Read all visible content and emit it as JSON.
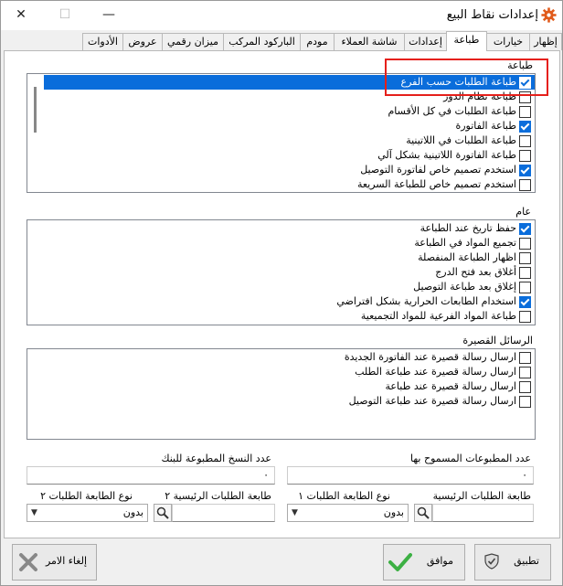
{
  "window": {
    "title": "إعدادات نقاط البيع",
    "close_label": "✕",
    "maximize_label": "☐",
    "minimize_label": "—"
  },
  "tabs": [
    {
      "label": "إظهار",
      "active": false
    },
    {
      "label": "خيارات",
      "active": false
    },
    {
      "label": "طباعة",
      "active": true
    },
    {
      "label": "إعدادات",
      "active": false
    },
    {
      "label": "شاشة العملاء",
      "active": false
    },
    {
      "label": "مودم",
      "active": false
    },
    {
      "label": "الباركود المركب",
      "active": false
    },
    {
      "label": "ميزان رقمي",
      "active": false
    },
    {
      "label": "عروض",
      "active": false
    },
    {
      "label": "الأدوات",
      "active": false
    }
  ],
  "print_section": {
    "title": "طباعة",
    "items": [
      {
        "label": "طباعة الطلبات حسب الفرع",
        "checked": true,
        "selected": true
      },
      {
        "label": "طباعة نظام الدور",
        "checked": false
      },
      {
        "label": "طباعة الطلبات في كل الأقسام",
        "checked": false
      },
      {
        "label": "طباعة الفاتورة",
        "checked": true
      },
      {
        "label": "طباعة الطلبات في اللاتينية",
        "checked": false
      },
      {
        "label": "طباعة الفاتورة اللاتينية بشكل آلي",
        "checked": false
      },
      {
        "label": "استخدم تصميم خاص لفاتورة التوصيل",
        "checked": true
      },
      {
        "label": "استخدم تصميم خاص للطباعة السريعة",
        "checked": false
      }
    ]
  },
  "general_section": {
    "title": "عام",
    "items": [
      {
        "label": "حفظ تاريخ عند الطباعة",
        "checked": true
      },
      {
        "label": "تجميع المواد في الطباعة",
        "checked": false
      },
      {
        "label": "اظهار الطباعة المنفصلة",
        "checked": false
      },
      {
        "label": "أغلاق بعد فتح الدرج",
        "checked": false
      },
      {
        "label": "إغلاق بعد طباعة التوصيل",
        "checked": false
      },
      {
        "label": "استخدام الطابعات الحرارية بشكل افتراضي",
        "checked": true
      },
      {
        "label": "طباعة المواد الفرعية للمواد التجميعية",
        "checked": false
      }
    ]
  },
  "sms_section": {
    "title": "الرسائل القصيرة",
    "items": [
      {
        "label": "ارسال رسالة قصيرة عند الفاتورة الجديدة",
        "checked": false
      },
      {
        "label": "ارسال رسالة قصيرة عند طباعة الطلب",
        "checked": false
      },
      {
        "label": "ارسال رسالة قصيرة عند طباعة",
        "checked": false
      },
      {
        "label": "ارسال رسالة قصيرة عند طباعة التوصيل",
        "checked": false
      }
    ]
  },
  "fields": {
    "allowed_prints_label": "عدد المطبوعات المسموح بها",
    "allowed_prints_value": "٠",
    "bank_copies_label": "عدد النسخ المطبوعة للبنك",
    "bank_copies_value": "٠",
    "main_orders_printer_label": "طابعة الطلبات الرئيسية",
    "order_printer_type1_label": "نوع الطابعة الطلبات ١",
    "order_printer_type1_value": "بدون",
    "main_orders_printer2_label": "طابعة الطلبات الرئيسية ٢",
    "order_printer_type2_label": "نوع الطابعة الطلبات ٢",
    "order_printer_type2_value": "بدون"
  },
  "buttons": {
    "apply": "تطبيق",
    "ok": "موافق",
    "cancel": "إلغاء الامر"
  },
  "colors": {
    "accent": "#0a6ddb",
    "highlight_box": "#e5201b",
    "gear": "#e05a1a",
    "ok_check": "#3cb043",
    "cancel_x": "#888888"
  }
}
